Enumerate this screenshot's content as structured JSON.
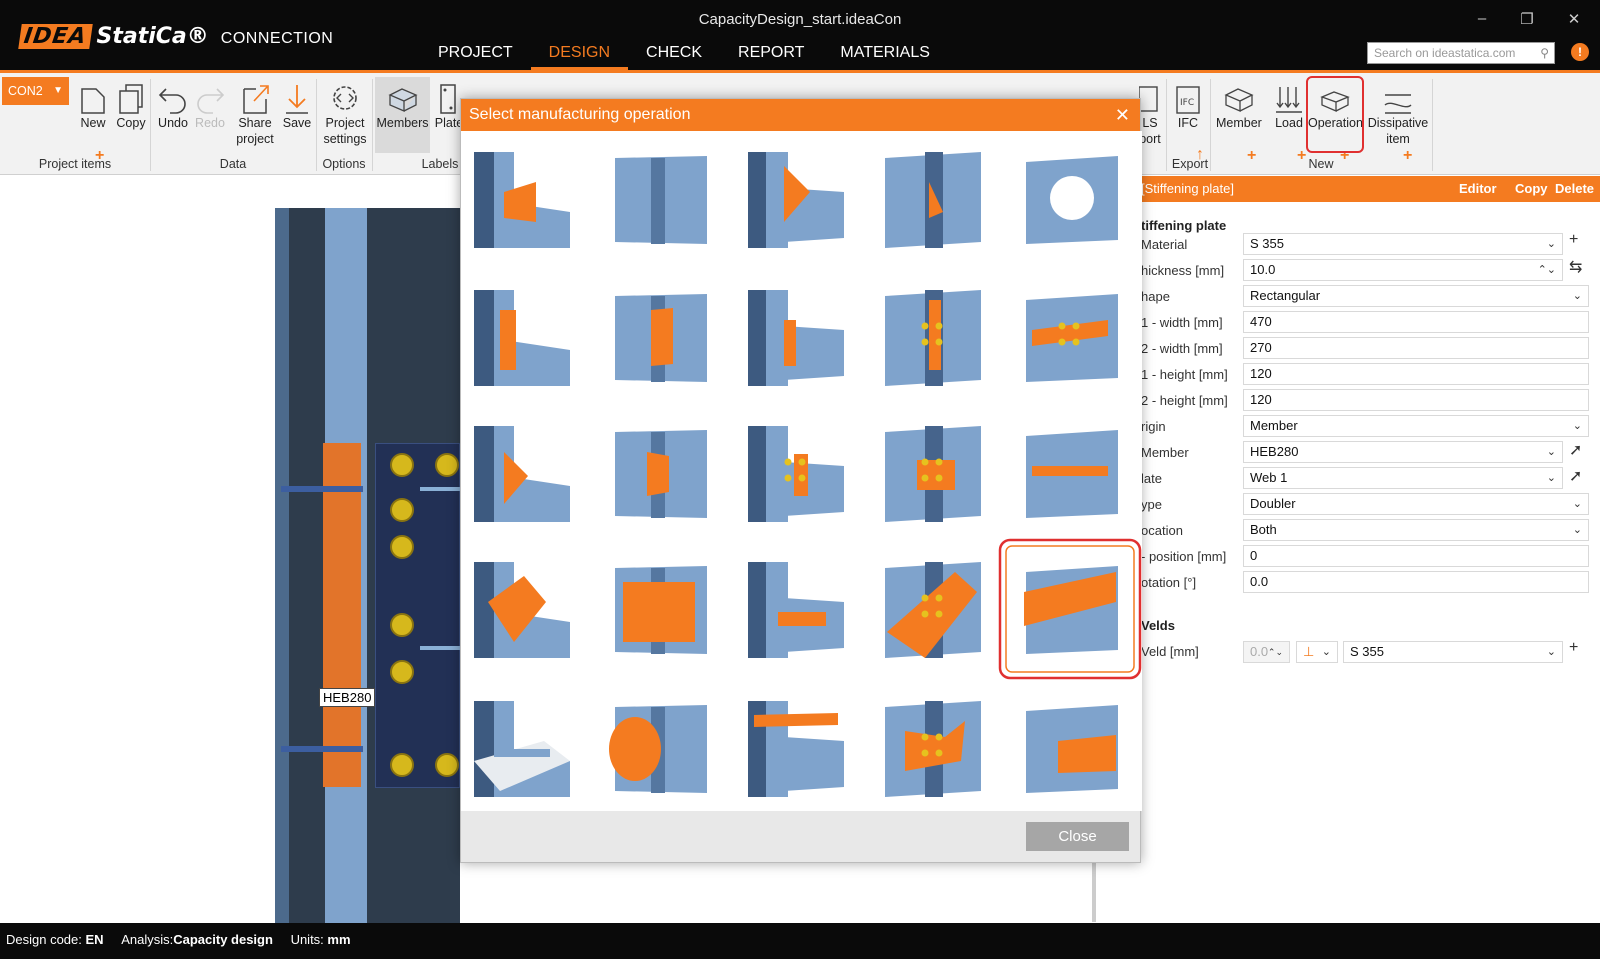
{
  "window": {
    "title": "CapacityDesign_start.ideaCon",
    "logo_part1": "IDEA",
    "logo_part2": "StatiCa®",
    "logo_part3": "CONNECTION",
    "minimize": "–",
    "restore": "❐",
    "close": "✕"
  },
  "menu": {
    "tabs": [
      "PROJECT",
      "DESIGN",
      "CHECK",
      "REPORT",
      "MATERIALS"
    ],
    "active": "DESIGN"
  },
  "search": {
    "placeholder": "Search on ideastatica.com"
  },
  "ribbon": {
    "connection_selector": "CON2",
    "buttons": {
      "new": "New",
      "copy": "Copy",
      "undo": "Undo",
      "redo": "Redo",
      "share": "Share project",
      "save": "Save",
      "settings": "Project settings",
      "members": "Members",
      "plates": "Plate",
      "ls_export": "LS port",
      "ifc": "IFC",
      "member": "Member",
      "load": "Load",
      "operation": "Operation",
      "dissipative": "Dissipative item"
    },
    "groups": {
      "project_items": "Project items",
      "data": "Data",
      "options": "Options",
      "labels": "Labels",
      "export": "Export",
      "new": "New"
    }
  },
  "viewport": {
    "member_label": "HEB280"
  },
  "dialog": {
    "title": "Select manufacturing operation",
    "close_label": "Close",
    "selected_index": 19,
    "operations": [
      "stiffener-operation-icon",
      "plate-operation-icon",
      "rib-operation-icon",
      "base-plate-operation-icon",
      "opening-operation-icon",
      "end-plate-operation-icon",
      "fin-plate-operation-icon",
      "cleat-operation-icon",
      "splice-operation-icon",
      "cover-plate-operation-icon",
      "bracing-operation-icon",
      "gusset-operation-icon",
      "cleat-bolts-operation-icon",
      "bolted-plate-operation-icon",
      "anchoring-operation-icon",
      "cut-operation-icon",
      "panel-plate-operation-icon",
      "haunch-operation-icon",
      "bolted-gusset-operation-icon",
      "stiffening-plate-operation-icon",
      "grid-plate-operation-icon",
      "tube-operation-icon",
      "widener-operation-icon",
      "truss-node-operation-icon",
      "beam-to-column-operation-icon"
    ]
  },
  "panel": {
    "header": "[Stiffening plate]",
    "actions": {
      "editor": "Editor",
      "copy": "Copy",
      "delete": "Delete"
    },
    "section": "tiffening plate",
    "fields": [
      {
        "label": "Material",
        "value": "S 355",
        "type": "select"
      },
      {
        "label": "hickness [mm]",
        "value": "10.0",
        "type": "spin"
      },
      {
        "label": "hape",
        "value": "Rectangular",
        "type": "select"
      },
      {
        "label": "1 - width [mm]",
        "value": "470",
        "type": "text"
      },
      {
        "label": "2 - width [mm]",
        "value": "270",
        "type": "text"
      },
      {
        "label": "1 - height [mm]",
        "value": "120",
        "type": "text"
      },
      {
        "label": "2 - height [mm]",
        "value": "120",
        "type": "text"
      },
      {
        "label": "rigin",
        "value": "Member",
        "type": "select"
      },
      {
        "label": "Member",
        "value": "HEB280",
        "type": "select"
      },
      {
        "label": "late",
        "value": "Web 1",
        "type": "select"
      },
      {
        "label": "ype",
        "value": "Doubler",
        "type": "select"
      },
      {
        "label": "ocation",
        "value": "Both",
        "type": "select"
      },
      {
        "label": "- position [mm]",
        "value": "0",
        "type": "text"
      },
      {
        "label": "otation [°]",
        "value": "0.0",
        "type": "text"
      }
    ],
    "welds_section": "Velds",
    "weld": {
      "label": "Veld [mm]",
      "thickness": "0.0",
      "material": "S 355"
    }
  },
  "status": {
    "design_code_label": "Design code:",
    "design_code": "EN",
    "analysis_label": "Analysis:",
    "analysis": "Capacity design",
    "units_label": "Units:",
    "units": "mm"
  },
  "colors": {
    "accent": "#f47b20",
    "highlight": "#e03030",
    "steel": "#7fa3cc",
    "dark_steel": "#2e3c4c"
  }
}
